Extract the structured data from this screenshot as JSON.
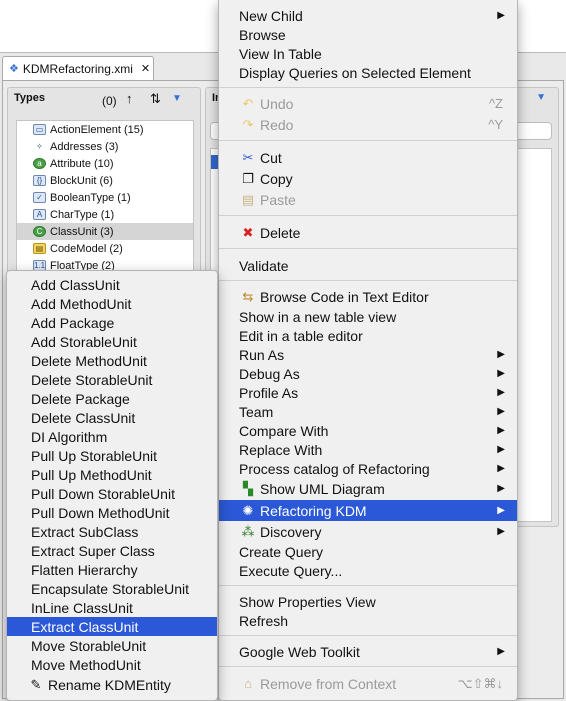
{
  "editor": {
    "tab_title": "KDMRefactoring.xmi",
    "tab_close": "✕",
    "types_panel": {
      "title": "Types",
      "count": "(0)",
      "items": [
        {
          "label": "ActionElement (15)",
          "icon": "action-element-icon"
        },
        {
          "label": "Addresses (3)",
          "icon": "addresses-icon"
        },
        {
          "label": "Attribute (10)",
          "icon": "attribute-icon"
        },
        {
          "label": "BlockUnit (6)",
          "icon": "block-unit-icon"
        },
        {
          "label": "BooleanType (1)",
          "icon": "boolean-type-icon"
        },
        {
          "label": "CharType (1)",
          "icon": "char-type-icon"
        },
        {
          "label": "ClassUnit (3)",
          "icon": "class-unit-icon",
          "selected": true
        },
        {
          "label": "CodeModel (2)",
          "icon": "code-model-icon"
        },
        {
          "label": "FloatType (2)",
          "icon": "float-type-icon"
        }
      ]
    },
    "instances_panel": {
      "title": "In"
    }
  },
  "main_menu": {
    "new_child": "New Child",
    "browse": "Browse",
    "view_in_table": "View In Table",
    "display_queries": "Display Queries on Selected Element",
    "undo": "Undo",
    "undo_sc": "^Z",
    "redo": "Redo",
    "redo_sc": "^Y",
    "cut": "Cut",
    "copy": "Copy",
    "paste": "Paste",
    "delete": "Delete",
    "validate": "Validate",
    "browse_code": "Browse Code in Text Editor",
    "show_new_table": "Show in a new table view",
    "edit_table": "Edit in a table editor",
    "run_as": "Run As",
    "debug_as": "Debug As",
    "profile_as": "Profile As",
    "team": "Team",
    "compare_with": "Compare With",
    "replace_with": "Replace With",
    "process_catalog": "Process catalog of Refactoring",
    "show_uml": "Show UML Diagram",
    "refactoring_kdm": "Refactoring KDM",
    "discovery": "Discovery",
    "create_query": "Create Query",
    "execute_query": "Execute Query...",
    "show_properties": "Show Properties View",
    "refresh": "Refresh",
    "google_web_toolkit": "Google Web Toolkit",
    "remove_context": "Remove from Context",
    "remove_context_sc": "⌥⇧⌘↓"
  },
  "sub_menu": {
    "items": [
      "Add ClassUnit",
      "Add MethodUnit",
      "Add Package",
      "Add StorableUnit",
      "Delete MethodUnit",
      "Delete StorableUnit",
      "Delete Package",
      "Delete ClassUnit",
      "DI Algorithm",
      "Pull Up StorableUnit",
      "Pull Up MethodUnit",
      "Pull Down StorableUnit",
      "Pull Down MethodUnit",
      "Extract SubClass",
      "Extract Super Class",
      "Flatten Hierarchy",
      "Encapsulate StorableUnit",
      "InLine ClassUnit",
      "Extract ClassUnit",
      "Move StorableUnit",
      "Move MethodUnit"
    ],
    "rename": "Rename KDMEntity"
  },
  "colors": {
    "highlight": "#2b58d6",
    "menu_bg": "#f0f0f0",
    "disabled": "#9a9a9a"
  }
}
